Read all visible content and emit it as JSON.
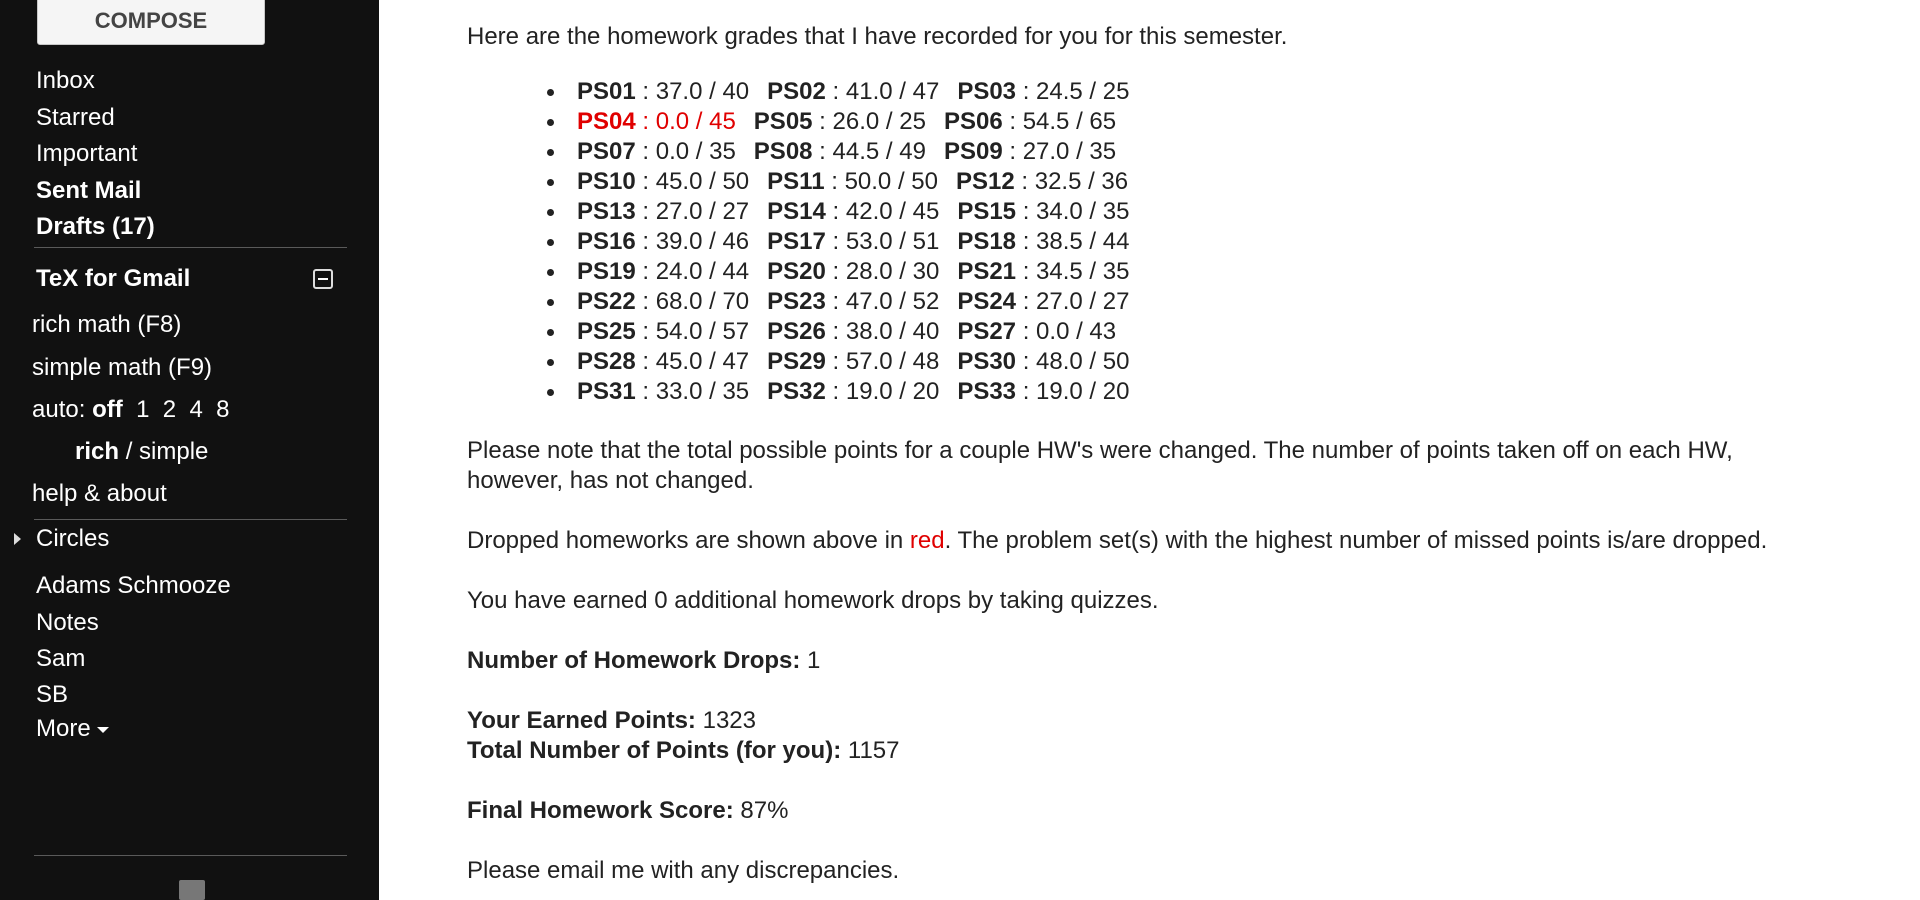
{
  "sidebar": {
    "compose_label": "COMPOSE",
    "nav": [
      "Inbox",
      "Starred",
      "Important",
      "Sent Mail",
      "Drafts (17)"
    ],
    "tex": {
      "title": "TeX for Gmail",
      "rich_math": "rich math (F8)",
      "simple_math": "simple math (F9)",
      "auto_label": "auto:",
      "auto_off": "off",
      "auto_options": [
        "1",
        "2",
        "4",
        "8"
      ],
      "rich": "rich",
      "slash": "/",
      "simple": "simple",
      "help": "help & about"
    },
    "circles_label": "Circles",
    "labels": [
      "Adams Schmooze",
      "Notes",
      "Sam",
      "SB"
    ],
    "more_label": "More"
  },
  "email": {
    "intro": "Here are the homework grades that I have recorded for you for this semester.",
    "grades": [
      [
        {
          "name": "PS01",
          "score": "37.0 / 40"
        },
        {
          "name": "PS02",
          "score": "41.0 / 47"
        },
        {
          "name": "PS03",
          "score": "24.5 / 25"
        }
      ],
      [
        {
          "name": "PS04",
          "score": "0.0 / 45",
          "dropped": true
        },
        {
          "name": "PS05",
          "score": "26.0 / 25"
        },
        {
          "name": "PS06",
          "score": "54.5 / 65"
        }
      ],
      [
        {
          "name": "PS07",
          "score": "0.0 / 35"
        },
        {
          "name": "PS08",
          "score": "44.5 / 49"
        },
        {
          "name": "PS09",
          "score": "27.0 / 35"
        }
      ],
      [
        {
          "name": "PS10",
          "score": "45.0 / 50"
        },
        {
          "name": "PS11",
          "score": "50.0 / 50"
        },
        {
          "name": "PS12",
          "score": "32.5 / 36"
        }
      ],
      [
        {
          "name": "PS13",
          "score": "27.0 / 27"
        },
        {
          "name": "PS14",
          "score": "42.0 / 45"
        },
        {
          "name": "PS15",
          "score": "34.0 / 35"
        }
      ],
      [
        {
          "name": "PS16",
          "score": "39.0 / 46"
        },
        {
          "name": "PS17",
          "score": "53.0 / 51"
        },
        {
          "name": "PS18",
          "score": "38.5 / 44"
        }
      ],
      [
        {
          "name": "PS19",
          "score": "24.0 / 44"
        },
        {
          "name": "PS20",
          "score": "28.0 / 30"
        },
        {
          "name": "PS21",
          "score": "34.5 / 35"
        }
      ],
      [
        {
          "name": "PS22",
          "score": "68.0 / 70"
        },
        {
          "name": "PS23",
          "score": "47.0 / 52"
        },
        {
          "name": "PS24",
          "score": "27.0 / 27"
        }
      ],
      [
        {
          "name": "PS25",
          "score": "54.0 / 57"
        },
        {
          "name": "PS26",
          "score": "38.0 / 40"
        },
        {
          "name": "PS27",
          "score": "0.0 / 43"
        }
      ],
      [
        {
          "name": "PS28",
          "score": "45.0 / 47"
        },
        {
          "name": "PS29",
          "score": "57.0 / 48"
        },
        {
          "name": "PS30",
          "score": "48.0 / 50"
        }
      ],
      [
        {
          "name": "PS31",
          "score": "33.0 / 35"
        },
        {
          "name": "PS32",
          "score": "19.0 / 20"
        },
        {
          "name": "PS33",
          "score": "19.0 / 20"
        }
      ]
    ],
    "note_line1": "Please note that the total possible points for a couple HW's were changed. The number of points taken off on each HW,",
    "note_line2": "however, has not changed.",
    "dropped_pre": "Dropped homeworks are shown above in ",
    "dropped_red": "red",
    "dropped_post": ". The problem set(s) with the highest number of missed points is/are dropped.",
    "earned_drops": "You have earned 0 additional homework drops by taking quizzes.",
    "num_drops_label": "Number of Homework Drops:",
    "num_drops_value": "1",
    "earned_points_label": "Your Earned Points:",
    "earned_points_value": "1323",
    "total_points_label": "Total Number of Points (for you):",
    "total_points_value": "1157",
    "final_label": "Final Homework Score:",
    "final_value": "87%",
    "closing": "Please email me with any discrepancies."
  },
  "colors": {
    "sidebar_bg": "#111111",
    "dropped": "#e00000"
  }
}
